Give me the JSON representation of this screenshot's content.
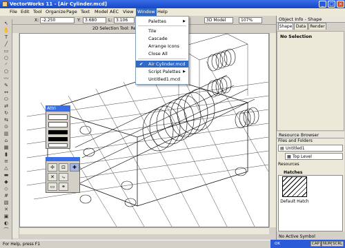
{
  "window": {
    "title": "VectorWorks 11 - [Air Cylinder.mcd]"
  },
  "menubar": [
    {
      "label": "File"
    },
    {
      "label": "Edit"
    },
    {
      "label": "Tool"
    },
    {
      "label": "Organize"
    },
    {
      "label": "Page"
    },
    {
      "label": "Text"
    },
    {
      "label": "Model"
    },
    {
      "label": "AEC"
    },
    {
      "label": "View"
    },
    {
      "label": "Window"
    },
    {
      "label": "Help"
    }
  ],
  "coords": {
    "x_label": "X:",
    "x_value": "-2.250",
    "y_label": "Y:",
    "y_value": "3.680",
    "l_label": "L:",
    "l_value": "3.106",
    "view_select": "3D Model",
    "zoom": "107%"
  },
  "layerbar": {
    "selection_text": "2D Selection Tool: Rec"
  },
  "window_menu": {
    "items": [
      {
        "label": "Palettes",
        "submenu": true
      },
      {
        "label": "Tile"
      },
      {
        "label": "Cascade"
      },
      {
        "label": "Arrange Icons"
      },
      {
        "label": "Close All"
      },
      {
        "label": "Air Cylinder.mcd",
        "checked": true
      },
      {
        "label": "Script Palettes",
        "submenu": true
      },
      {
        "label": "Untitled1.mcd"
      }
    ]
  },
  "attr_palette": {
    "title": "Attri"
  },
  "right_panel": {
    "title": "Object Info - Shape",
    "tabs": [
      {
        "label": "Shape"
      },
      {
        "label": "Data"
      },
      {
        "label": "Render"
      }
    ],
    "selection": "No Selection"
  },
  "resource_browser": {
    "title": "Resource Browser",
    "files_label": "Files and Folders",
    "file": "Untitled1",
    "level": "Top Level",
    "resources_label": "Resources",
    "hatches_label": "Hatches",
    "hatch_name": "Default Hatch",
    "active_symbol": "No Active Symbol"
  },
  "statusbar": {
    "text": "For Help, press F1"
  },
  "tray": {
    "ok_label": "OK",
    "keys": [
      "CAP",
      "NUM",
      "SCRL"
    ]
  },
  "icons": {
    "window_menu_check": "check-icon",
    "submenu_arrow": "triangle-right-icon"
  }
}
